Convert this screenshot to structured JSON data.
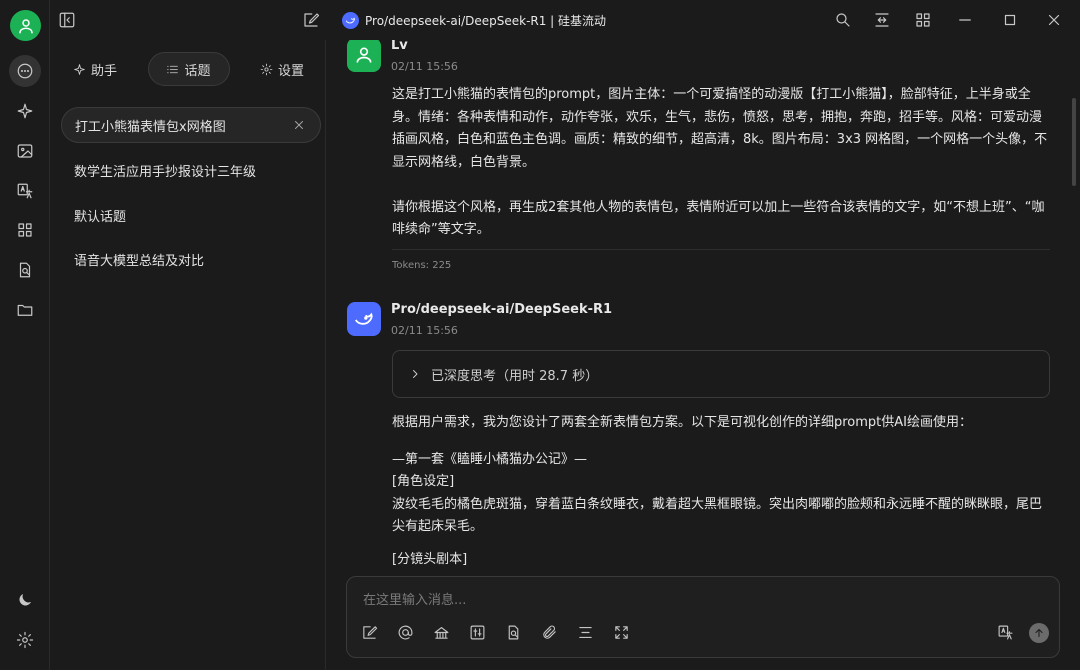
{
  "titlebar": {
    "model_title": "Pro/deepseek-ai/DeepSeek-R1 | 硅基流动"
  },
  "rail": {
    "icons": [
      "avatar-icon",
      "chat-icon",
      "sparkle-icon",
      "image-icon",
      "translate-icon",
      "apps-icon",
      "file-search-icon",
      "folder-icon",
      "moon-icon",
      "settings-gear-icon"
    ]
  },
  "topics_panel": {
    "tabs": [
      {
        "label": "助手",
        "icon": "sparkle-icon"
      },
      {
        "label": "话题",
        "icon": "list-icon",
        "active": true
      },
      {
        "label": "设置",
        "icon": "gear-icon"
      }
    ],
    "items": [
      {
        "label": "打工小熊猫表情包x网格图",
        "active": true
      },
      {
        "label": "数学生活应用手抄报设计三年级"
      },
      {
        "label": "默认话题"
      },
      {
        "label": "语音大模型总结及对比"
      }
    ]
  },
  "messages": [
    {
      "author": "Lv",
      "time": "02/11 15:56",
      "paragraphs": [
        " 这是打工小熊猫的表情包的prompt，图片主体：一个可爱搞怪的动漫版【打工小熊猫】，脸部特征，上半身或全身。情绪：各种表情和动作，动作夸张，欢乐，生气，悲伤，愤怒，思考，拥抱，奔跑，招手等。风格：可爱动漫插画风格，白色和蓝色主色调。画质：精致的细节，超高清，8k。图片布局：3x3 网格图，一个网格一个头像，不显示网格线，白色背景。",
        "请你根据这个风格，再生成2套其他人物的表情包，表情附近可以加上一些符合该表情的文字，如“不想上班”、“咖啡续命”等文字。"
      ],
      "tokens": "Tokens: 225"
    },
    {
      "author": "Pro/deepseek-ai/DeepSeek-R1",
      "time": "02/11 15:56",
      "thinking": "已深度思考（用时 28.7 秒）",
      "lines": [
        "根据用户需求，我为您设计了两套全新表情包方案。以下是可视化创作的详细prompt供AI绘画使用：",
        "—第一套《瞌睡小橘猫办公记》—",
        "[角色设定]",
        "波纹毛毛的橘色虎斑猫，穿着蓝白条纹睡衣，戴着超大黑框眼镜。突出肉嘟嘟的脸颊和永远睡不醒的眯眯眼，尾巴尖有起床呆毛。",
        "[分镜头剧本]"
      ]
    }
  ],
  "input": {
    "placeholder": "在这里输入消息..."
  },
  "colors": {
    "background": "#1b1b1b",
    "user_avatar": "#1db155",
    "assistant_avatar": "#4d6bfe",
    "border": "#3a3a3a"
  }
}
